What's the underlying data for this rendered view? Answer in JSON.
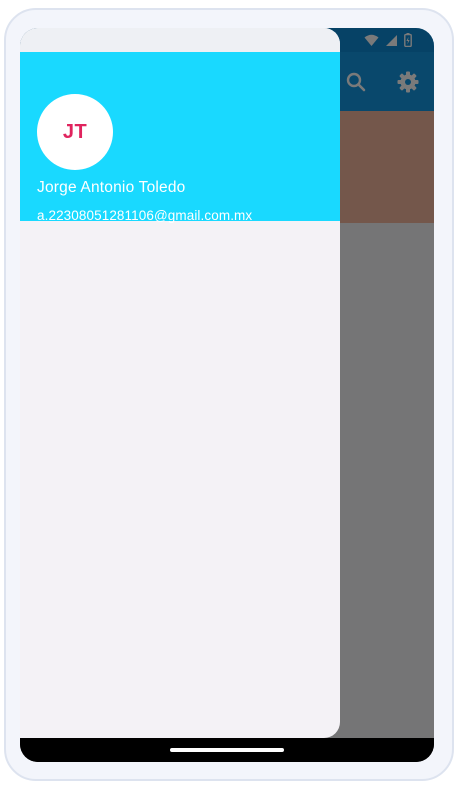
{
  "account": {
    "initials": "JT",
    "name": "Jorge Antonio Toledo",
    "email": "a.22308051281106@gmail.com.mx"
  },
  "app_bar": {
    "icons": [
      "search-icon",
      "settings-icon"
    ]
  },
  "status_bar": {
    "icons": [
      "wifi-icon",
      "cellular-signal-icon",
      "battery-icon"
    ]
  },
  "colors": {
    "drawer_header": "#19d9ff",
    "avatar_text": "#e0245e",
    "app_bar": "#1397e2",
    "drawer_background": "#f4f2f6"
  }
}
